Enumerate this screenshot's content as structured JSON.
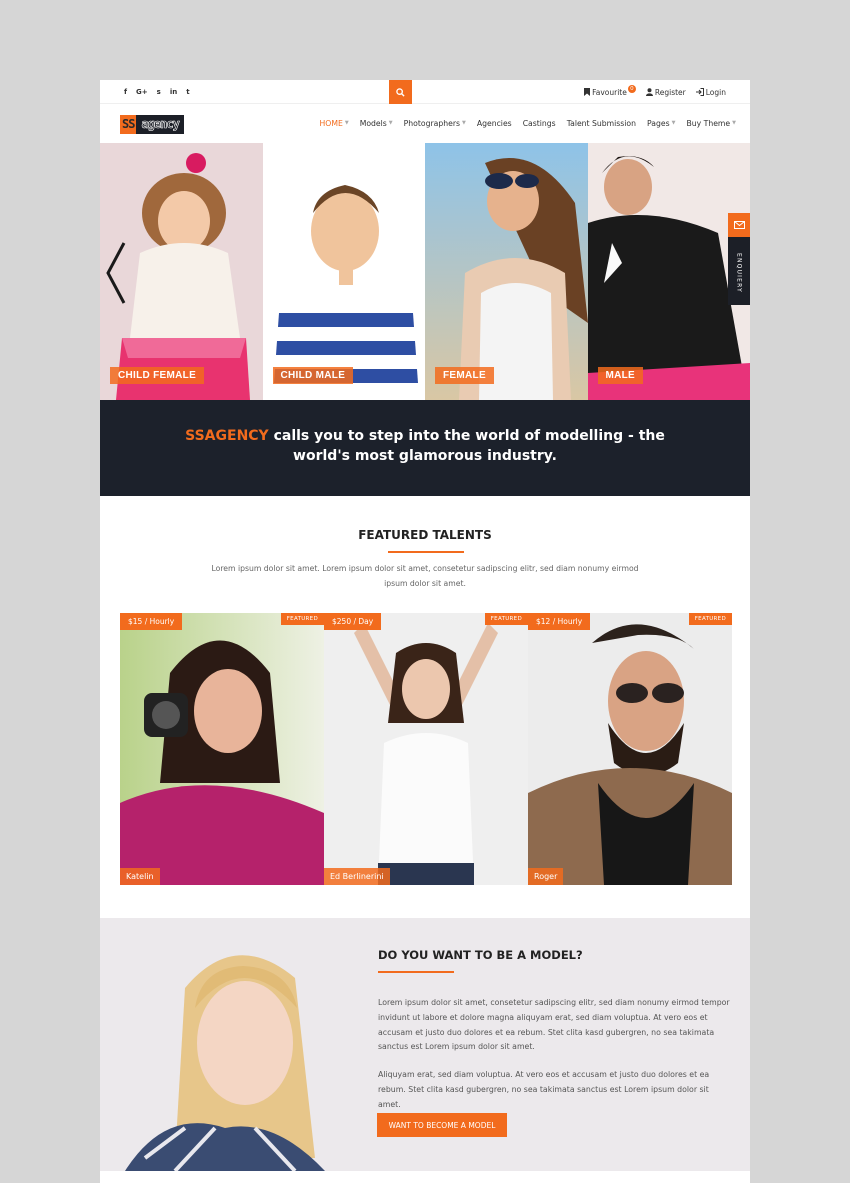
{
  "topbar": {
    "social": [
      "f",
      "G+",
      "s",
      "in",
      "t"
    ],
    "social_icons": [
      "facebook-icon",
      "google-plus-icon",
      "skype-icon",
      "linkedin-icon",
      "twitter-icon"
    ],
    "favourite_label": "Favourite",
    "favourite_count": "0",
    "register_label": "Register",
    "login_label": "Login"
  },
  "nav": {
    "logo_text_1": "SS",
    "logo_text_2": "agency",
    "items": [
      {
        "label": "HOME",
        "active": true,
        "dropdown": true
      },
      {
        "label": "Models",
        "dropdown": true
      },
      {
        "label": "Photographers",
        "dropdown": true
      },
      {
        "label": "Agencies",
        "dropdown": false
      },
      {
        "label": "Castings",
        "dropdown": false
      },
      {
        "label": "Talent Submission",
        "dropdown": false
      },
      {
        "label": "Pages",
        "dropdown": true
      },
      {
        "label": "Buy Theme",
        "dropdown": true
      }
    ]
  },
  "slider": {
    "slides": [
      {
        "label": "CHILD FEMALE"
      },
      {
        "label": "CHILD MALE"
      },
      {
        "label": "FEMALE"
      },
      {
        "label": "MALE"
      }
    ],
    "enquiry_label": "ENQUIERY"
  },
  "banner": {
    "brand": "SSAGENCY",
    "text": " calls you to step into the world of modelling - the world's most glamorous industry."
  },
  "featured": {
    "title": "FEATURED TALENTS",
    "description": "Lorem ipsum dolor sit amet. Lorem ipsum dolor sit amet, consetetur sadipscing elitr, sed diam nonumy eirmod ipsum dolor sit amet.",
    "cards": [
      {
        "price": "$15 / Hourly",
        "badge": "FEATURED",
        "name": "Katelin"
      },
      {
        "price": "$250 / Day",
        "badge": "FEATURED",
        "name": "Ed Berlinerini"
      },
      {
        "price": "$12 / Hourly",
        "badge": "FEATURED",
        "name": "Roger"
      }
    ]
  },
  "model_section": {
    "title": "DO YOU WANT TO BE A MODEL?",
    "paragraph_1": "Lorem ipsum dolor sit amet, consetetur sadipscing elitr, sed diam nonumy eirmod tempor invidunt ut labore et dolore magna aliquyam erat, sed diam voluptua. At vero eos et accusam et justo duo dolores et ea rebum. Stet clita kasd gubergren, no sea takimata sanctus est Lorem ipsum dolor sit amet.",
    "paragraph_2": "Aliquyam erat, sed diam voluptua. At vero eos et accusam et justo duo dolores et ea rebum. Stet clita kasd gubergren, no sea takimata sanctus est Lorem ipsum dolor sit amet.",
    "button_label": "WANT TO BECOME A MODEL"
  },
  "colors": {
    "accent": "#f26b1d",
    "dark": "#1c212b"
  }
}
